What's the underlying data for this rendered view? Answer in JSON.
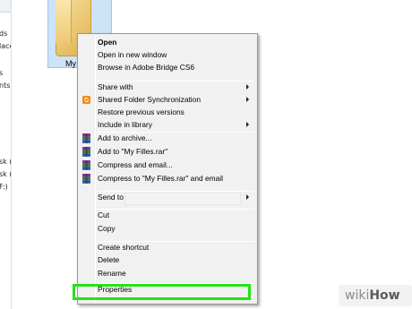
{
  "navigation": {
    "items": [
      "ds",
      "laces",
      "s",
      "nts",
      "sk (C:)",
      "sk (D:)",
      "F:)"
    ]
  },
  "file_area": {
    "folder_label": "My"
  },
  "context_menu": {
    "items": [
      {
        "label": "Open",
        "bold": true,
        "icon": null,
        "submenu": false
      },
      {
        "label": "Open in new window",
        "bold": false,
        "icon": null,
        "submenu": false
      },
      {
        "label": "Browse in Adobe Bridge CS6",
        "bold": false,
        "icon": null,
        "submenu": false
      },
      {
        "label": "Share with",
        "bold": false,
        "icon": null,
        "submenu": true
      },
      {
        "label": "Shared Folder Synchronization",
        "bold": false,
        "icon": "sync-icon",
        "submenu": true
      },
      {
        "label": "Restore previous versions",
        "bold": false,
        "icon": null,
        "submenu": false
      },
      {
        "label": "Include in library",
        "bold": false,
        "icon": null,
        "submenu": true
      },
      {
        "label": "Add to archive...",
        "bold": false,
        "icon": "winrar-icon",
        "submenu": false
      },
      {
        "label": "Add to \"My Filles.rar\"",
        "bold": false,
        "icon": "winrar-icon",
        "submenu": false
      },
      {
        "label": "Compress and email...",
        "bold": false,
        "icon": "winrar-icon",
        "submenu": false
      },
      {
        "label": "Compress to \"My Filles.rar\" and email",
        "bold": false,
        "icon": "winrar-icon",
        "submenu": false
      },
      {
        "label": "Send to",
        "bold": false,
        "icon": null,
        "submenu": true
      },
      {
        "label": "Cut",
        "bold": false,
        "icon": null,
        "submenu": false
      },
      {
        "label": "Copy",
        "bold": false,
        "icon": null,
        "submenu": false
      },
      {
        "label": "Create shortcut",
        "bold": false,
        "icon": null,
        "submenu": false
      },
      {
        "label": "Delete",
        "bold": false,
        "icon": null,
        "submenu": false
      },
      {
        "label": "Rename",
        "bold": false,
        "icon": null,
        "submenu": false
      },
      {
        "label": "Properties",
        "bold": false,
        "icon": null,
        "submenu": false
      }
    ]
  },
  "colors": {
    "highlight": "#22e317",
    "selection": "#cde3f8",
    "menu_bg": "#f1f1f1"
  },
  "watermark": {
    "wiki": "wiki",
    "how": "How"
  }
}
